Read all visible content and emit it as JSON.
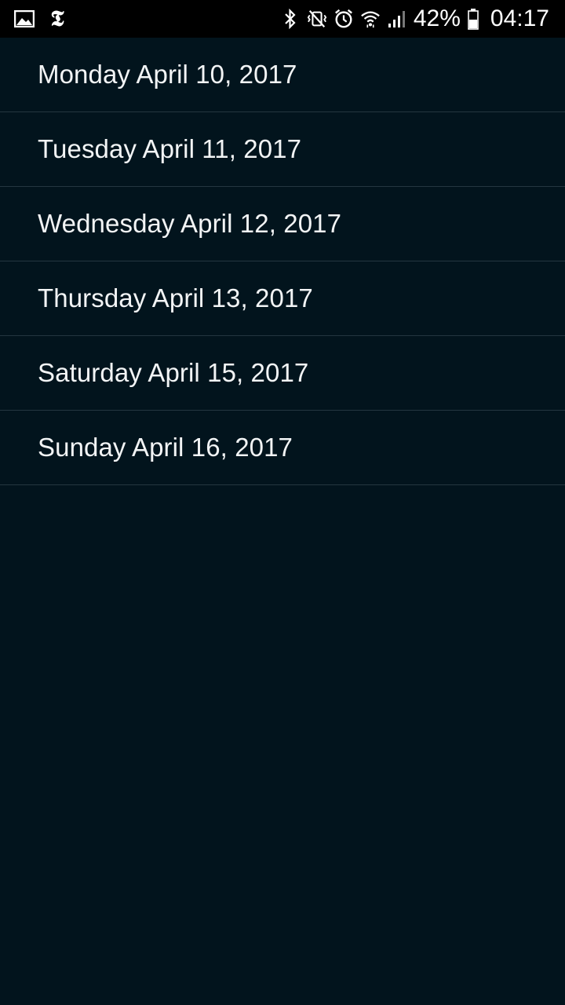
{
  "status_bar": {
    "left_icons": [
      "gallery-icon",
      "nyt-logo-icon"
    ],
    "right_icons": [
      "bluetooth-icon",
      "vibrate-mute-icon",
      "alarm-icon",
      "wifi-icon",
      "signal-icon",
      "battery-icon"
    ],
    "battery_percent": "42%",
    "time": "04:17"
  },
  "dates": {
    "items": [
      {
        "label": "Monday April 10, 2017"
      },
      {
        "label": "Tuesday April 11, 2017"
      },
      {
        "label": "Wednesday April 12, 2017"
      },
      {
        "label": "Thursday April 13, 2017"
      },
      {
        "label": "Saturday April 15, 2017"
      },
      {
        "label": "Sunday April 16, 2017"
      }
    ]
  },
  "colors": {
    "background": "#02141d",
    "divider": "#243640",
    "status_bar": "#000000",
    "text": "#f2f4f5"
  }
}
